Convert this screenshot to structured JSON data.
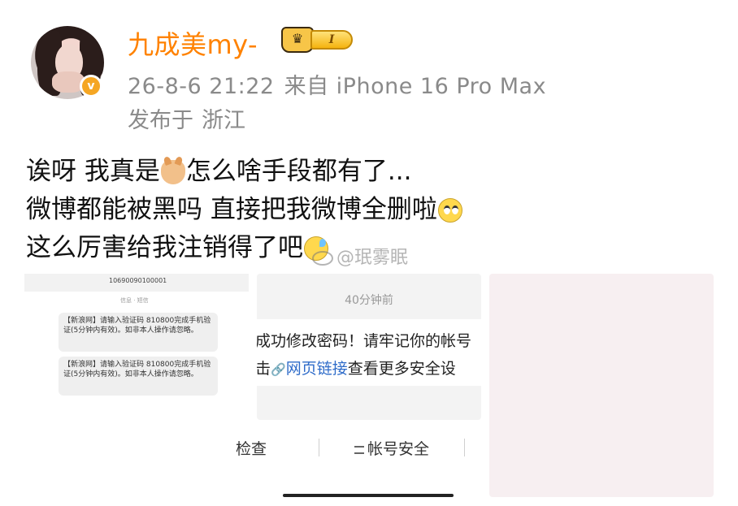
{
  "post": {
    "username": "九成美my-",
    "vip_level": "I",
    "vip_crown": "♛",
    "verified_mark": "v",
    "timestamp": "26-8-6 21:22",
    "source": "来自 iPhone 16 Pro Max",
    "location_prefix": "发布于",
    "location": "浙江",
    "lines": [
      {
        "a": "诶呀 我真是",
        "b": "怎么啥手段都有了..."
      },
      {
        "a": "微博都能被黑吗 直接把我微博全删啦",
        "b": ""
      },
      {
        "a": "这么厉害给我注销得了吧",
        "b": ""
      }
    ],
    "watermark": "@珉雾眠"
  },
  "images": {
    "sms": {
      "sender": "10690090100001",
      "info": "信息 · 短信",
      "bubble1": "【新浪网】请输入验证码 810800完成手机验证(5分钟内有效)。如非本人操作请忽略。",
      "bubble2": "【新浪网】请输入验证码 810800完成手机验证(5分钟内有效)。如非本人操作请忽略。"
    },
    "notice": {
      "time": "40分钟前",
      "msg1": "成功修改密码！请牢记你的帐号",
      "msg2_prefix": "击",
      "link_text": "网页链接",
      "msg2_suffix": "查看更多安全设",
      "action_check": "检查",
      "action_account": "帐号安全"
    }
  }
}
